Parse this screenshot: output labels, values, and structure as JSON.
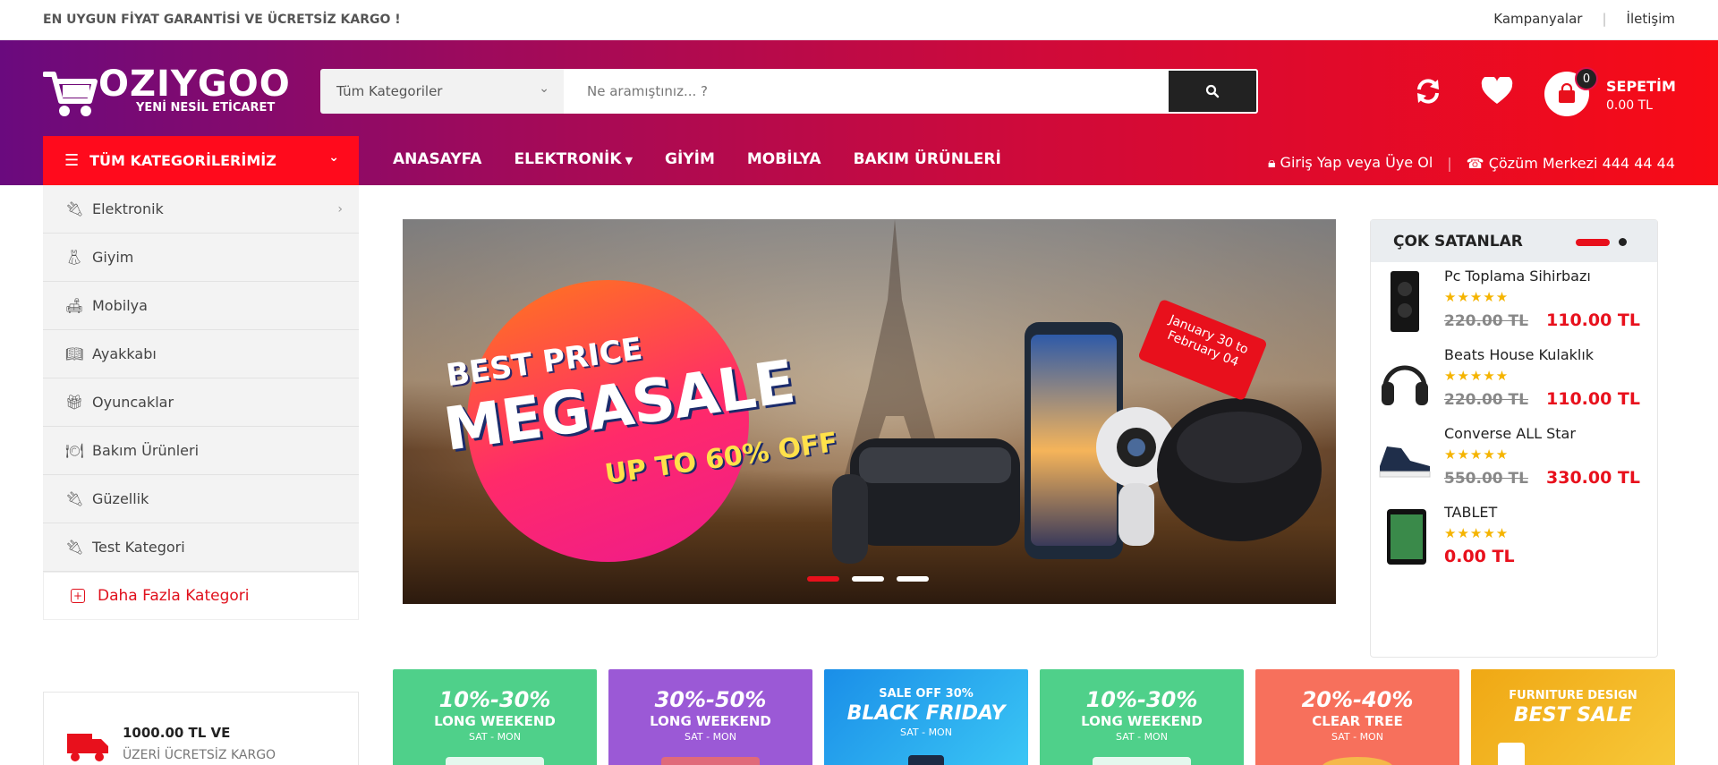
{
  "topbar": {
    "promo": "EN UYGUN FİYAT GARANTİSİ VE ÜCRETSİZ KARGO !",
    "links": [
      "Kampanyalar",
      "İletişim"
    ],
    "separator": "|"
  },
  "header": {
    "brand": "OZIYGOO",
    "tagline": "YENİ NESİL ETİCARET",
    "category_select": "Tüm Kategoriler",
    "search_placeholder": "Ne aramıştınız... ?",
    "cart": {
      "count": "0",
      "label": "SEPETİM",
      "total": "0.00 TL"
    }
  },
  "nav": {
    "all_categories": "TÜM KATEGORİLERİMİZ",
    "items": [
      "ANASAYFA",
      "ELEKTRONİK",
      "GİYİM",
      "MOBİLYA",
      "BAKIM ÜRÜNLERİ"
    ],
    "login": "Giriş Yap veya Üye Ol",
    "support": "Çözüm Merkezi 444 44 44"
  },
  "sidebar": {
    "items": [
      {
        "label": "Elektronik",
        "icon": "plug-icon"
      },
      {
        "label": "Giyim",
        "icon": "dress-icon"
      },
      {
        "label": "Mobilya",
        "icon": "sofa-icon"
      },
      {
        "label": "Ayakkabı",
        "icon": "book-icon"
      },
      {
        "label": "Oyuncaklar",
        "icon": "gift-icon"
      },
      {
        "label": "Bakım Ürünleri",
        "icon": "dish-icon"
      },
      {
        "label": "Güzellik",
        "icon": "plug-icon"
      },
      {
        "label": "Test Kategori",
        "icon": "plug-icon"
      }
    ],
    "more": "Daha Fazla Kategori"
  },
  "banner": {
    "best_price": "BEST PRICE",
    "megasale": "MEGASALE",
    "upto": "UP TO 60% OFF",
    "tag": "January 30 to February 04"
  },
  "best_sellers": {
    "title": "ÇOK SATANLAR",
    "products": [
      {
        "name": "Pc Toplama Sihirbazı",
        "old": "220.00 TL",
        "new": "110.00 TL",
        "rating": 5
      },
      {
        "name": "Beats House Kulaklık",
        "old": "220.00 TL",
        "new": "110.00 TL",
        "rating": 5
      },
      {
        "name": "Converse ALL Star",
        "old": "550.00 TL",
        "new": "330.00 TL",
        "rating": 5
      },
      {
        "name": "TABLET",
        "old": "",
        "new": "0.00 TL",
        "rating": 5
      }
    ],
    "stars": "★★★★★"
  },
  "shipping": {
    "line1": "1000.00 TL VE",
    "line2": "ÜZERİ ÜCRETSİZ KARGO"
  },
  "tiles": [
    {
      "l1": "10%-30%",
      "l2": "LONG WEEKEND",
      "l3": "SAT - MON",
      "color": "#4fd08a"
    },
    {
      "l1": "30%-50%",
      "l2": "LONG WEEKEND",
      "l3": "SAT - MON",
      "color": "#9b59d6"
    },
    {
      "l1": "BLACK FRIDAY",
      "l2": "SALE OFF 30%",
      "l3": "SAT - MON",
      "color": "#2eaef0"
    },
    {
      "l1": "10%-30%",
      "l2": "LONG WEEKEND",
      "l3": "SAT - MON",
      "color": "#4fd08a"
    },
    {
      "l1": "20%-40%",
      "l2": "CLEAR TREE",
      "l3": "SAT - MON",
      "color": "#f7705c"
    },
    {
      "l1": "BEST SALE",
      "l2": "FURNITURE DESIGN",
      "l3": "",
      "color": "#f5b81a"
    }
  ]
}
